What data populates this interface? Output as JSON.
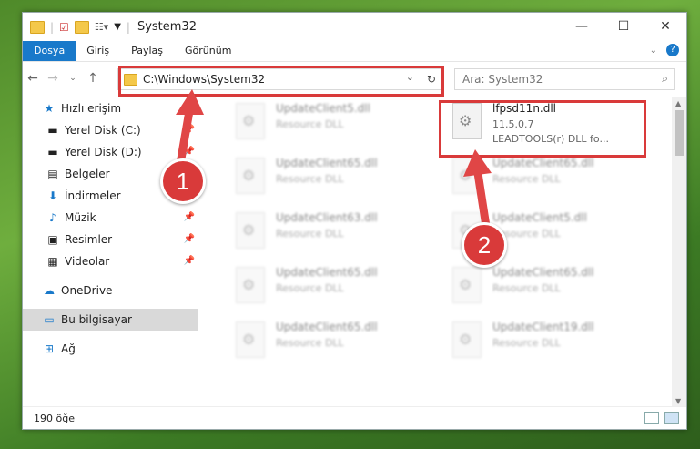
{
  "window": {
    "title": "System32",
    "controls": {
      "minimize": "—",
      "maximize": "☐",
      "close": "✕"
    }
  },
  "ribbon": {
    "tabs": [
      "Dosya",
      "Giriş",
      "Paylaş",
      "Görünüm"
    ]
  },
  "nav": {
    "address": "C:\\Windows\\System32",
    "search_placeholder": "Ara: System32"
  },
  "sidebar": {
    "items": [
      {
        "label": "Hızlı erişim",
        "icon": "star-icon"
      },
      {
        "label": "Yerel Disk (C:)",
        "icon": "drive-icon"
      },
      {
        "label": "Yerel Disk (D:)",
        "icon": "drive-icon"
      },
      {
        "label": "Belgeler",
        "icon": "documents-icon"
      },
      {
        "label": "İndirmeler",
        "icon": "download-icon"
      },
      {
        "label": "Müzik",
        "icon": "music-icon"
      },
      {
        "label": "Resimler",
        "icon": "pictures-icon"
      },
      {
        "label": "Videolar",
        "icon": "videos-icon"
      },
      {
        "label": "OneDrive",
        "icon": "cloud-icon"
      },
      {
        "label": "Bu bilgisayar",
        "icon": "computer-icon"
      },
      {
        "label": "Ağ",
        "icon": "network-icon"
      }
    ]
  },
  "files": {
    "highlighted": {
      "name": "lfpsd11n.dll",
      "version": "11.5.0.7",
      "description": "LEADTOOLS(r) DLL fo..."
    },
    "blurred": [
      {
        "name": "UpdateClient5.dll",
        "desc": "Resource DLL"
      },
      {
        "name": "UpdateClient65.dll",
        "desc": "Resource DLL"
      },
      {
        "name": "UpdateClient65.dll",
        "desc": "Resource DLL"
      },
      {
        "name": "UpdateClient63.dll",
        "desc": "Resource DLL"
      },
      {
        "name": "UpdateClient5.dll",
        "desc": "Resource DLL"
      },
      {
        "name": "UpdateClient65.dll",
        "desc": "Resource DLL"
      },
      {
        "name": "UpdateClient65.dll",
        "desc": "Resource DLL"
      },
      {
        "name": "UpdateClient65.dll",
        "desc": "Resource DLL"
      },
      {
        "name": "UpdateClient19.dll",
        "desc": "Resource DLL"
      }
    ]
  },
  "status": {
    "item_count": "190 öğe"
  },
  "annotations": {
    "badge1": "1",
    "badge2": "2"
  },
  "colors": {
    "highlight": "#d93a3a",
    "accent": "#1979ca"
  }
}
